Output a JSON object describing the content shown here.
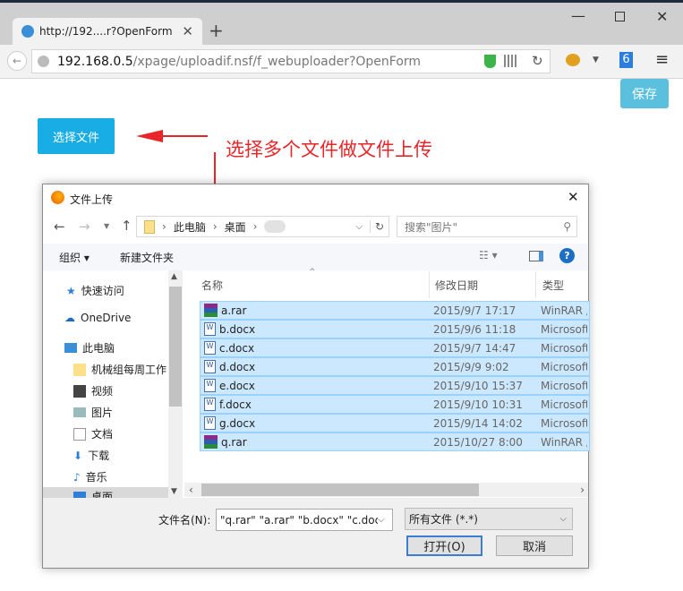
{
  "browser": {
    "tab_title": "http://192....r?OpenForm",
    "url_host": "192.168.0.5",
    "url_path": "/xpage/uploadif.nsf/f_webuploader?OpenForm"
  },
  "page": {
    "save_label": "保存",
    "select_file_label": "选择文件",
    "annotation": "选择多个文件做文件上传"
  },
  "dialog": {
    "title": "文件上传",
    "breadcrumb": [
      "此电脑",
      "桌面"
    ],
    "search_placeholder": "搜索\"图片\"",
    "organize": "组织 ▾",
    "new_folder": "新建文件夹",
    "columns": {
      "name": "名称",
      "date": "修改日期",
      "type": "类型"
    },
    "sidebar": [
      {
        "label": "快速访问",
        "icon": "star-icon"
      },
      {
        "label": "OneDrive",
        "icon": "cloud-icon"
      },
      {
        "label": "此电脑",
        "icon": "computer-icon"
      },
      {
        "label": "机械组每周工作",
        "icon": "folder-icon"
      },
      {
        "label": "视频",
        "icon": "video-icon"
      },
      {
        "label": "图片",
        "icon": "picture-icon"
      },
      {
        "label": "文档",
        "icon": "document-icon"
      },
      {
        "label": "下载",
        "icon": "download-icon"
      },
      {
        "label": "音乐",
        "icon": "music-icon"
      },
      {
        "label": "桌面",
        "icon": "desktop-icon"
      }
    ],
    "files": [
      {
        "name": "a.rar",
        "date": "2015/9/7 17:17",
        "type": "WinRAR 压缩文件",
        "kind": "rar"
      },
      {
        "name": "b.docx",
        "date": "2015/9/6 11:18",
        "type": "Microsoft Word",
        "kind": "doc"
      },
      {
        "name": "c.docx",
        "date": "2015/9/7 14:47",
        "type": "Microsoft Word",
        "kind": "doc"
      },
      {
        "name": "d.docx",
        "date": "2015/9/9 9:02",
        "type": "Microsoft Word",
        "kind": "doc"
      },
      {
        "name": "e.docx",
        "date": "2015/9/10 15:37",
        "type": "Microsoft Word",
        "kind": "doc"
      },
      {
        "name": "f.docx",
        "date": "2015/9/10 10:31",
        "type": "Microsoft Word",
        "kind": "doc"
      },
      {
        "name": "g.docx",
        "date": "2015/9/14 14:02",
        "type": "Microsoft Word",
        "kind": "doc"
      },
      {
        "name": "q.rar",
        "date": "2015/10/27 8:00",
        "type": "WinRAR 压缩文件",
        "kind": "rar"
      }
    ],
    "filename_label": "文件名(N):",
    "filename_value": "\"q.rar\" \"a.rar\" \"b.docx\" \"c.docx\" \"d.docx\" \"e.docx\" \"f.docx\" \"g.docx\"",
    "filetype": "所有文件 (*.*)",
    "open_label": "打开(O)",
    "cancel_label": "取消"
  }
}
